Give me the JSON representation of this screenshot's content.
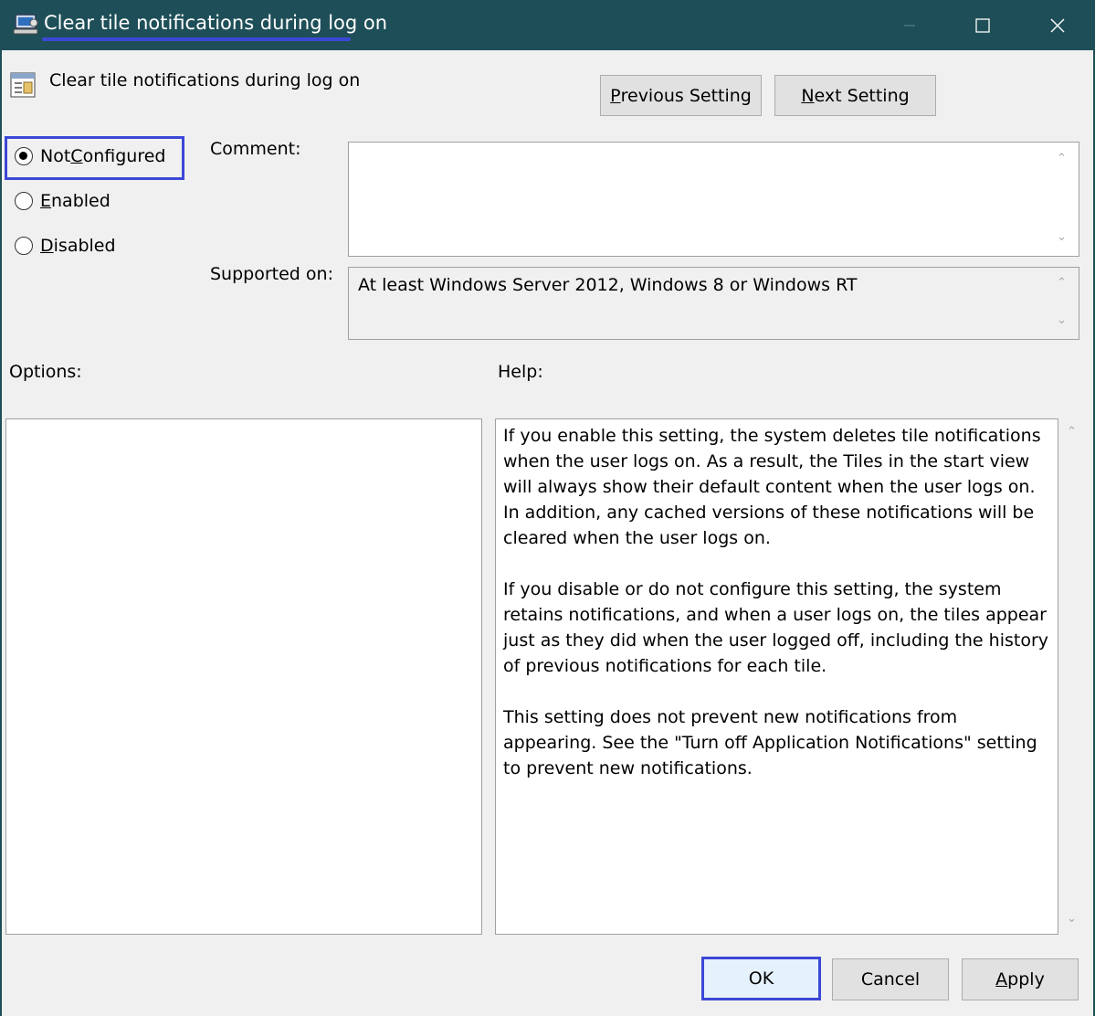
{
  "window": {
    "title": "Clear tile notifications during log on",
    "controls": {
      "minimize": "minimize-icon",
      "maximize": "maximize-icon",
      "close": "close-icon"
    }
  },
  "header": {
    "policy_name": "Clear tile notifications during log on",
    "previous_setting": {
      "prefix": "",
      "accel": "P",
      "rest": "revious Setting"
    },
    "next_setting": {
      "prefix": "",
      "accel": "N",
      "rest": "ext Setting"
    }
  },
  "state": {
    "selected": "Not Configured",
    "options": [
      {
        "prefix": "Not ",
        "accel": "C",
        "rest": "onfigured"
      },
      {
        "prefix": "",
        "accel": "E",
        "rest": "nabled"
      },
      {
        "prefix": "",
        "accel": "D",
        "rest": "isabled"
      }
    ]
  },
  "fields": {
    "comment_label": "Comment:",
    "comment_value": "",
    "supported_label": "Supported on:",
    "supported_value": "At least Windows Server 2012, Windows 8 or Windows RT"
  },
  "panels": {
    "options_label": "Options:",
    "help_label": "Help:",
    "help_paragraphs": [
      "If you enable this setting, the system deletes tile notifications when the user logs on. As a result, the Tiles in the start view will always show their default content when the user logs on. In addition, any cached versions of these notifications will be cleared when the user logs on.",
      "If you disable or do not configure this setting, the system retains notifications, and when a user logs on, the tiles appear just as they did when the user logged off, including the history of previous notifications for each tile.",
      "This setting does not prevent new notifications from appearing. See the \"Turn off Application Notifications\" setting to prevent new notifications."
    ]
  },
  "footer": {
    "ok": "OK",
    "cancel": "Cancel",
    "apply": {
      "prefix": "",
      "accel": "A",
      "rest": "pply"
    }
  },
  "colors": {
    "titlebar": "#1e4f58",
    "highlight": "#3b48d6",
    "dialog_bg": "#f0f0f0"
  }
}
